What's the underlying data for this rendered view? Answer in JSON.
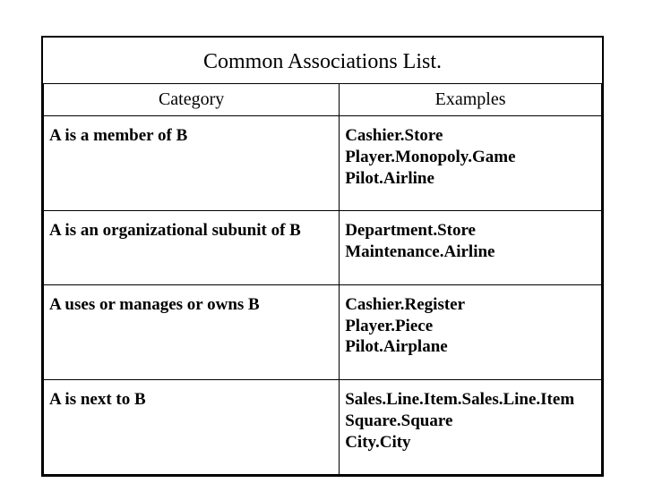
{
  "title": "Common Associations List.",
  "headers": {
    "col1": "Category",
    "col2": "Examples"
  },
  "rows": [
    {
      "category": "A is a member of B",
      "examples": "Cashier.Store\nPlayer.Monopoly.Game\nPilot.Airline"
    },
    {
      "category": "A is an organizational subunit of B",
      "examples": "Department.Store\nMaintenance.Airline"
    },
    {
      "category": "A uses or manages or owns B",
      "examples": "Cashier.Register\nPlayer.Piece\nPilot.Airplane"
    },
    {
      "category": "A is next to B",
      "examples": "Sales.Line.Item.Sales.Line.Item\nSquare.Square\nCity.City"
    }
  ]
}
